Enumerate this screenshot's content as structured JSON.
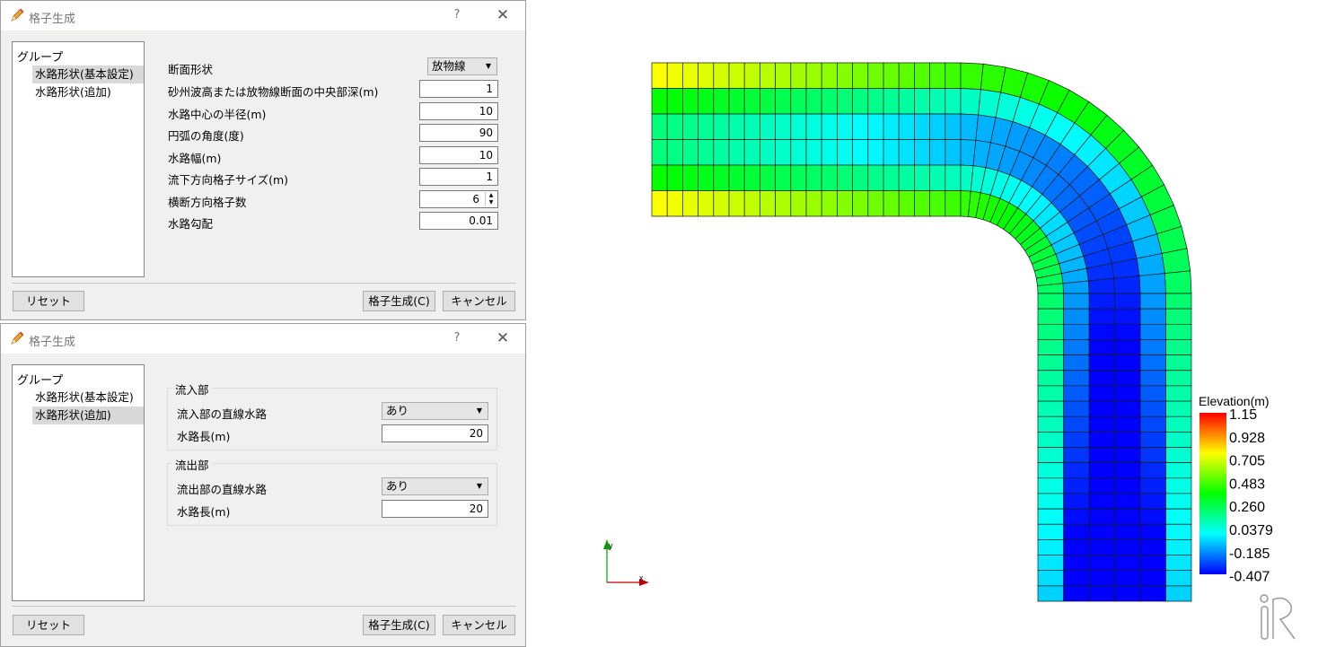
{
  "dialog_top": {
    "title": "格子生成",
    "help": "?",
    "close": "✕",
    "group_header": "グループ",
    "group_items": [
      "水路形状(基本設定)",
      "水路形状(追加)"
    ],
    "fields": {
      "section_shape_label": "断面形状",
      "section_shape_value": "放物線",
      "depth_label": "砂州波高または放物線断面の中央部深(m)",
      "depth_value": "1",
      "radius_label": "水路中心の半径(m)",
      "radius_value": "10",
      "angle_label": "円弧の角度(度)",
      "angle_value": "90",
      "width_label": "水路幅(m)",
      "width_value": "10",
      "stream_size_label": "流下方向格子サイズ(m)",
      "stream_size_value": "1",
      "cross_count_label": "横断方向格子数",
      "cross_count_value": "6",
      "slope_label": "水路勾配",
      "slope_value": "0.01"
    },
    "reset": "リセット",
    "generate": "格子生成(C)",
    "cancel": "キャンセル"
  },
  "dialog_bottom": {
    "title": "格子生成",
    "help": "?",
    "close": "✕",
    "group_header": "グループ",
    "group_items": [
      "水路形状(基本設定)",
      "水路形状(追加)"
    ],
    "inflow": {
      "title": "流入部",
      "straight_label": "流入部の直線水路",
      "straight_value": "あり",
      "length_label": "水路長(m)",
      "length_value": "20"
    },
    "outflow": {
      "title": "流出部",
      "straight_label": "流出部の直線水路",
      "straight_value": "あり",
      "length_label": "水路長(m)",
      "length_value": "20"
    },
    "reset": "リセット",
    "generate": "格子生成(C)",
    "cancel": "キャンセル"
  },
  "viewport": {
    "colorbar_title": "Elevation(m)",
    "colorbar_labels": [
      "1.15",
      "0.928",
      "0.705",
      "0.483",
      "0.260",
      "0.0379",
      "-0.185",
      "-0.407"
    ],
    "axis_x": "x",
    "axis_y": "y",
    "logo_text": "iRIC",
    "colors": {
      "axis_x": "#c00000",
      "axis_y": "#00a000",
      "grid_line": "#1a1a1a"
    }
  }
}
